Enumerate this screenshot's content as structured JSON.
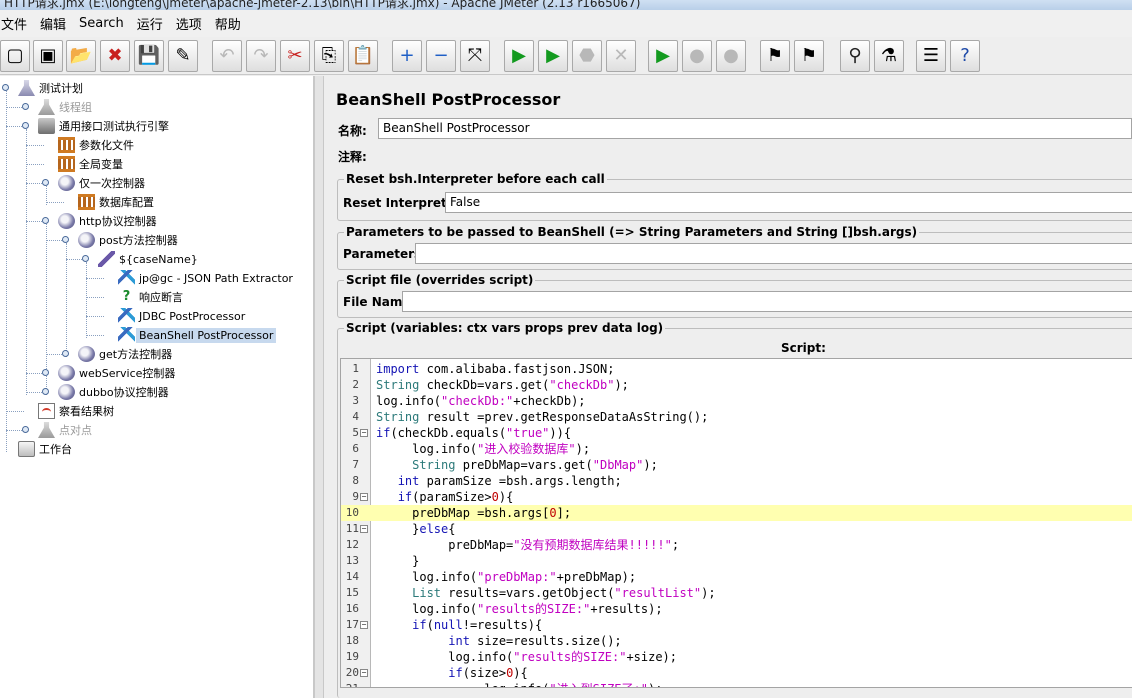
{
  "window": {
    "title": "HTTP请求.jmx (E:\\longteng\\jmeter\\apache-jmeter-2.13\\bin\\HTTP请求.jmx) - Apache JMeter (2.13 r1665067)"
  },
  "menu": [
    "文件",
    "编辑",
    "Search",
    "运行",
    "选项",
    "帮助"
  ],
  "toolbar": [
    {
      "name": "new-icon",
      "glyph": "▢",
      "enabled": true
    },
    {
      "name": "templates-icon",
      "glyph": "▣",
      "enabled": true
    },
    {
      "name": "open-icon",
      "glyph": "📂",
      "enabled": true
    },
    {
      "name": "close-icon",
      "glyph": "✖",
      "enabled": true
    },
    {
      "name": "save-icon",
      "glyph": "💾",
      "enabled": true
    },
    {
      "name": "save-as-icon",
      "glyph": "✎",
      "enabled": true
    },
    {
      "name": "undo-icon",
      "glyph": "↶",
      "enabled": false
    },
    {
      "name": "redo-icon",
      "glyph": "↷",
      "enabled": false
    },
    {
      "name": "cut-icon",
      "glyph": "✂",
      "enabled": true
    },
    {
      "name": "copy-icon",
      "glyph": "⎘",
      "enabled": true
    },
    {
      "name": "paste-icon",
      "glyph": "📋",
      "enabled": true
    },
    {
      "name": "expand-icon",
      "glyph": "+",
      "enabled": true
    },
    {
      "name": "collapse-icon",
      "glyph": "−",
      "enabled": true
    },
    {
      "name": "toggle-icon",
      "glyph": "⤧",
      "enabled": true
    },
    {
      "name": "start-icon",
      "glyph": "▶",
      "enabled": true
    },
    {
      "name": "start-no-timers-icon",
      "glyph": "▶",
      "enabled": true
    },
    {
      "name": "stop-icon",
      "glyph": "⬣",
      "enabled": false
    },
    {
      "name": "shutdown-icon",
      "glyph": "✕",
      "enabled": false
    },
    {
      "name": "remote-start-icon",
      "glyph": "▶",
      "enabled": true
    },
    {
      "name": "remote-stop-icon",
      "glyph": "●",
      "enabled": false
    },
    {
      "name": "remote-shutdown-icon",
      "glyph": "●",
      "enabled": false
    },
    {
      "name": "clear-icon",
      "glyph": "⚑",
      "enabled": true
    },
    {
      "name": "clear-all-icon",
      "glyph": "⚑",
      "enabled": true
    },
    {
      "name": "search-icon",
      "glyph": "⚲",
      "enabled": true
    },
    {
      "name": "reset-search-icon",
      "glyph": "⚗",
      "enabled": true
    },
    {
      "name": "function-helper-icon",
      "glyph": "☰",
      "enabled": true
    },
    {
      "name": "help-icon",
      "glyph": "?",
      "enabled": true
    }
  ],
  "tree": [
    {
      "label": "测试计划",
      "icon": "flask-icon",
      "type": "flask",
      "disabled": false,
      "selected": false
    },
    {
      "label": "线程组",
      "icon": "thread-group-icon",
      "type": "gray",
      "disabled": true,
      "selected": false
    },
    {
      "label": "通用接口测试执行引擎",
      "icon": "thread-group-icon",
      "type": "thread",
      "disabled": false,
      "selected": false
    },
    {
      "label": "参数化文件",
      "icon": "config-element-icon",
      "type": "fence",
      "disabled": false,
      "selected": false
    },
    {
      "label": "全局变量",
      "icon": "config-element-icon",
      "type": "fence",
      "disabled": false,
      "selected": false
    },
    {
      "label": "仅一次控制器",
      "icon": "controller-icon",
      "type": "ctrl",
      "disabled": false,
      "selected": false
    },
    {
      "label": "数据库配置",
      "icon": "config-element-icon",
      "type": "fence",
      "disabled": false,
      "selected": false
    },
    {
      "label": "http协议控制器",
      "icon": "controller-icon",
      "type": "ctrl",
      "disabled": false,
      "selected": false
    },
    {
      "label": "post方法控制器",
      "icon": "controller-icon",
      "type": "ctrl",
      "disabled": false,
      "selected": false
    },
    {
      "label": "${caseName}",
      "icon": "sampler-icon",
      "type": "pen",
      "disabled": false,
      "selected": false
    },
    {
      "label": "jp@gc - JSON Path Extractor",
      "icon": "post-processor-icon",
      "type": "post",
      "disabled": false,
      "selected": false
    },
    {
      "label": "响应断言",
      "icon": "assertion-icon",
      "type": "quest",
      "disabled": false,
      "selected": false
    },
    {
      "label": "JDBC PostProcessor",
      "icon": "post-processor-icon",
      "type": "post",
      "disabled": false,
      "selected": false
    },
    {
      "label": "BeanShell PostProcessor",
      "icon": "post-processor-icon",
      "type": "post",
      "disabled": false,
      "selected": true
    },
    {
      "label": "get方法控制器",
      "icon": "controller-icon",
      "type": "ctrl",
      "disabled": false,
      "selected": false
    },
    {
      "label": "webService控制器",
      "icon": "controller-icon",
      "type": "ctrl",
      "disabled": false,
      "selected": false
    },
    {
      "label": "dubbo协议控制器",
      "icon": "controller-icon",
      "type": "ctrl",
      "disabled": false,
      "selected": false
    },
    {
      "label": "察看结果树",
      "icon": "listener-icon",
      "type": "view",
      "disabled": false,
      "selected": false
    },
    {
      "label": "点对点",
      "icon": "thread-group-icon",
      "type": "gray",
      "disabled": true,
      "selected": false
    },
    {
      "label": "工作台",
      "icon": "workbench-icon",
      "type": "bench",
      "disabled": false,
      "selected": false
    }
  ],
  "panel": {
    "title": "BeanShell PostProcessor",
    "name_label": "名称:",
    "name_value": "BeanShell PostProcessor",
    "comment_label": "注释:",
    "comment_value": "",
    "reset_group_title": "Reset bsh.Interpreter before each call",
    "reset_label": "Reset Interpreter:",
    "reset_value": "False",
    "params_group_title": "Parameters to be passed to BeanShell (=> String Parameters and String []bsh.args)",
    "params_label": "Parameters:",
    "params_value": "",
    "file_group_title": "Script file (overrides script)",
    "file_label": "File Name:",
    "file_value": "",
    "script_group_title": "Script (variables: ctx vars props prev data log)",
    "script_label": "Script:"
  },
  "script": {
    "highlight_line": 10,
    "lines": [
      "import com.alibaba.fastjson.JSON;",
      "String checkDb=vars.get(\"checkDb\");",
      "log.info(\"checkDb:\"+checkDb);",
      "String result =prev.getResponseDataAsString();",
      "if(checkDb.equals(\"true\")){",
      "     log.info(\"进入校验数据库\");",
      "     String preDbMap=vars.get(\"DbMap\");",
      "   int paramSize =bsh.args.length;",
      "   if(paramSize>0){",
      "     preDbMap =bsh.args[0];",
      "     }else{",
      "          preDbMap=\"没有预期数据库结果!!!!!\";",
      "     }",
      "     log.info(\"preDbMap:\"+preDbMap);",
      "     List results=vars.getObject(\"resultList\");",
      "     log.info(\"results的SIZE:\"+results);",
      "     if(null!=results){",
      "          int size=results.size();",
      "          log.info(\"results的SIZE:\"+size);",
      "          if(size>0){",
      "               log.info(\"进入到SIZE了:\");"
    ],
    "folds": [
      5,
      9,
      11,
      17,
      20
    ]
  }
}
